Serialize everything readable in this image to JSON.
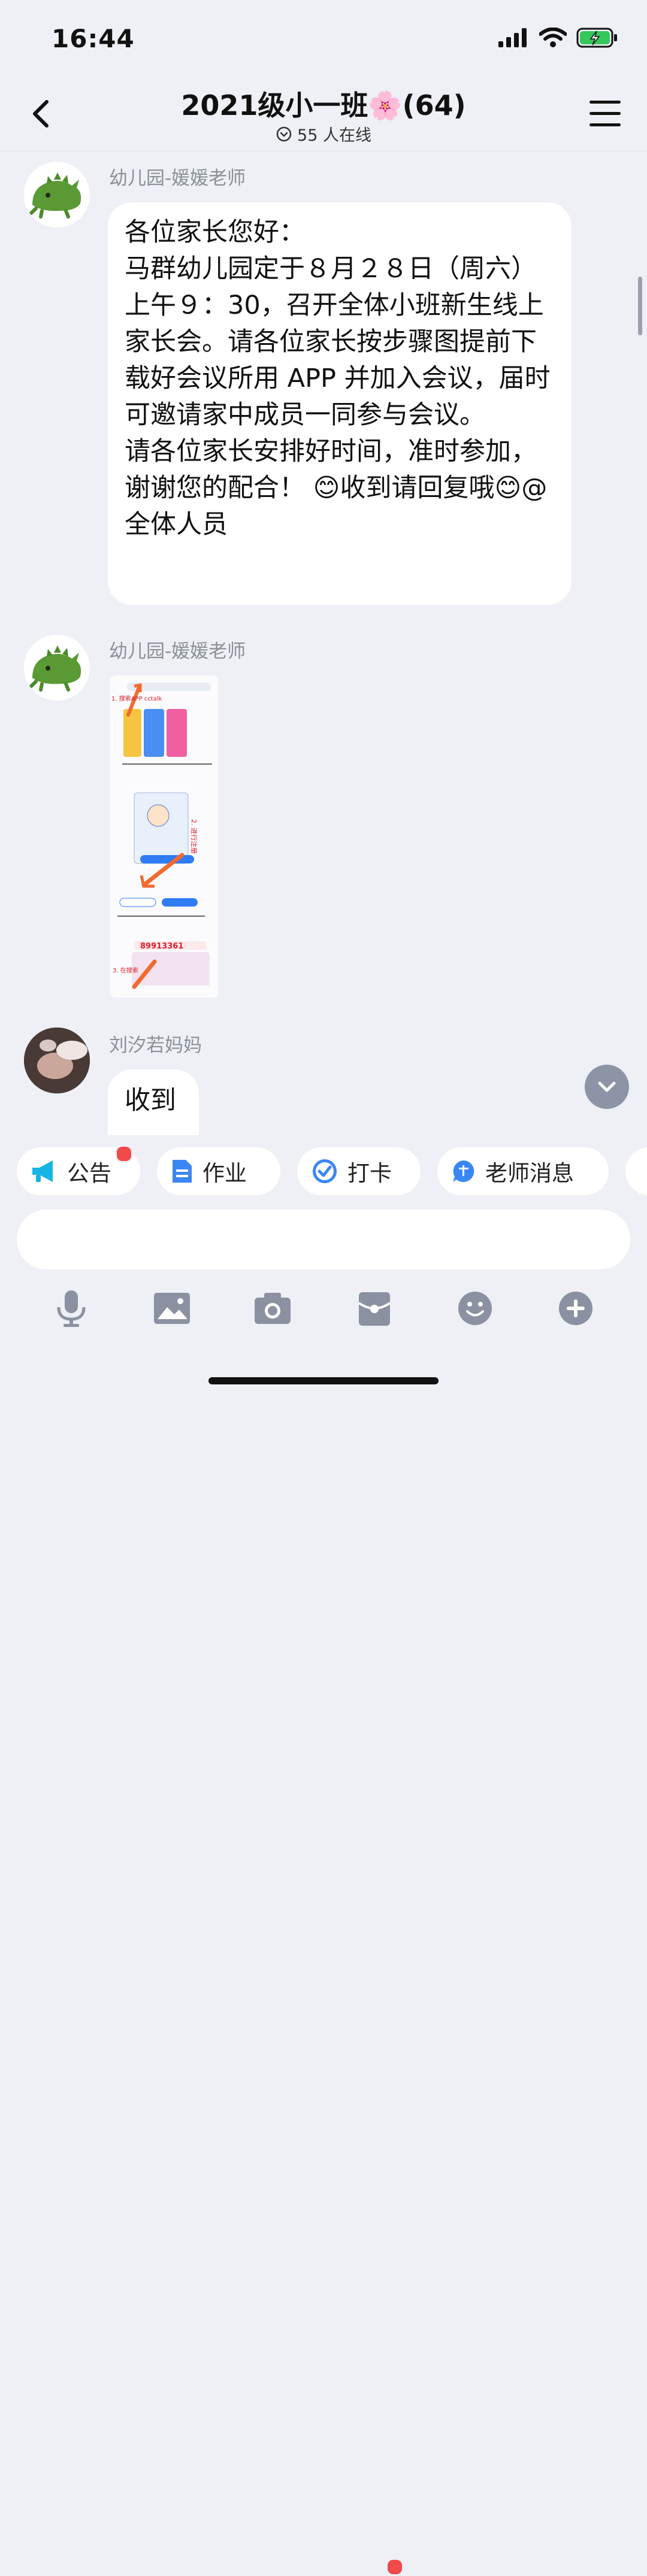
{
  "status": {
    "time": "16:44"
  },
  "header": {
    "title": "2021级小一班🌸(64)",
    "online": "55 人在线"
  },
  "messages": [
    {
      "sender": "幼儿园-媛媛老师",
      "text": "各位家长您好：\n马群幼儿园定于８月２８日（周六）上午９：30，召开全体小班新生线上家长会。请各位家长按步骤图提前下载好会议所用 APP 并加入会议，届时可邀请家中成员一同参与会议。\n请各位家长安排好时间，准时参加，谢谢您的配合！ 😊收到请回复哦😊@全体人员"
    },
    {
      "sender": "幼儿园-媛媛老师",
      "image": {
        "step1": "1. 搜索APP cctalk",
        "step2": "2. 进行注册",
        "step3": "3. 在搜索",
        "code": "89913361"
      }
    },
    {
      "sender": "刘汐若妈妈",
      "text": "收到"
    }
  ],
  "quick_actions": [
    {
      "label": "公告",
      "icon": "megaphone-icon"
    },
    {
      "label": "作业",
      "icon": "document-icon"
    },
    {
      "label": "打卡",
      "icon": "checkin-icon"
    },
    {
      "label": "老师消息",
      "icon": "teacher-icon"
    }
  ],
  "colors": {
    "accent": "#2f7cf6",
    "badge": "#f04a4a"
  }
}
